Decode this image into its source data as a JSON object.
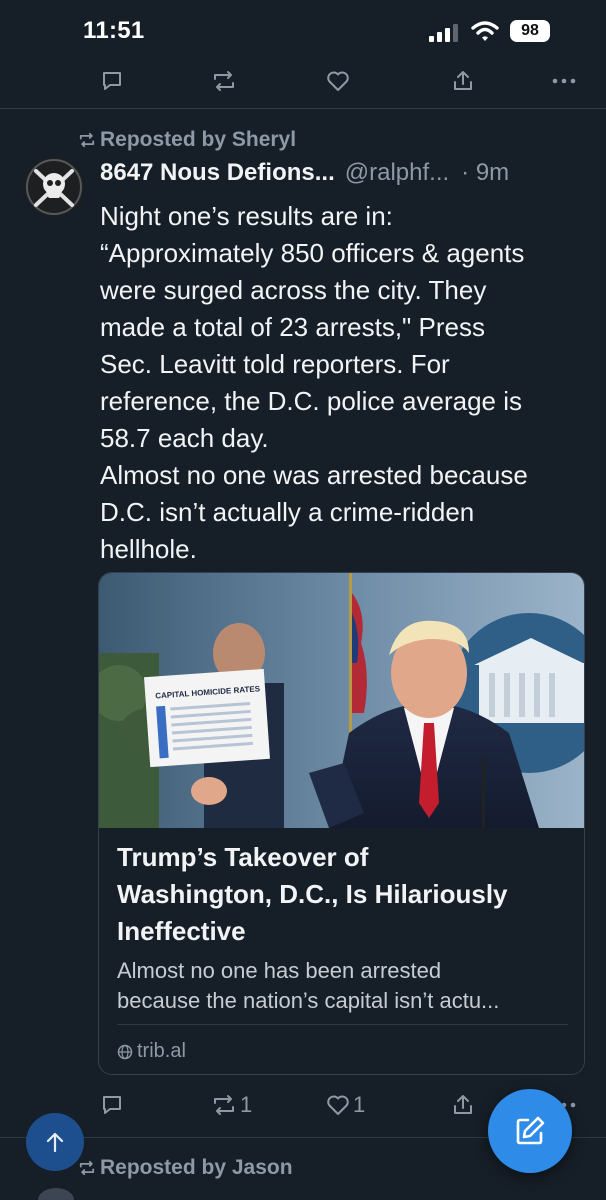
{
  "status_bar": {
    "time": "11:51",
    "battery": "98"
  },
  "feed_top_actions": {
    "icons": [
      "reply-icon",
      "repost-icon",
      "like-icon",
      "share-icon",
      "more-icon"
    ]
  },
  "post": {
    "repost_label": "Reposted by Sheryl",
    "author_name": "8647 Nous Defions...",
    "handle": "@ralphf...",
    "time": "· 9m",
    "text_lines": [
      "Night one’s results are in:",
      "“Approximately 850 officers & agents",
      "were surged across the city. They",
      "made a total of 23 arrests,\" Press",
      "Sec. Leavitt told reporters. For",
      "reference, the D.C. police average is",
      "58.7 each day.",
      "Almost no one was arrested because",
      "D.C. isn’t actually a crime-ridden",
      "hellhole."
    ],
    "link_card": {
      "image_sign_text": "CAPITAL HOMICIDE RATES",
      "title_lines": [
        "Trump’s Takeover of",
        "Washington, D.C., Is Hilariously",
        "Ineffective"
      ],
      "description_lines": [
        "Almost no one has been arrested",
        "because the nation’s capital isn’t actu..."
      ],
      "domain": "trib.al"
    },
    "actions": {
      "reposts": "1",
      "likes": "1"
    }
  },
  "next_post": {
    "repost_label": "Reposted by Jason"
  },
  "colors": {
    "background": "#161e27",
    "accent": "#2f8be8",
    "muted": "#8d99a7",
    "text": "#f1f3f5"
  }
}
